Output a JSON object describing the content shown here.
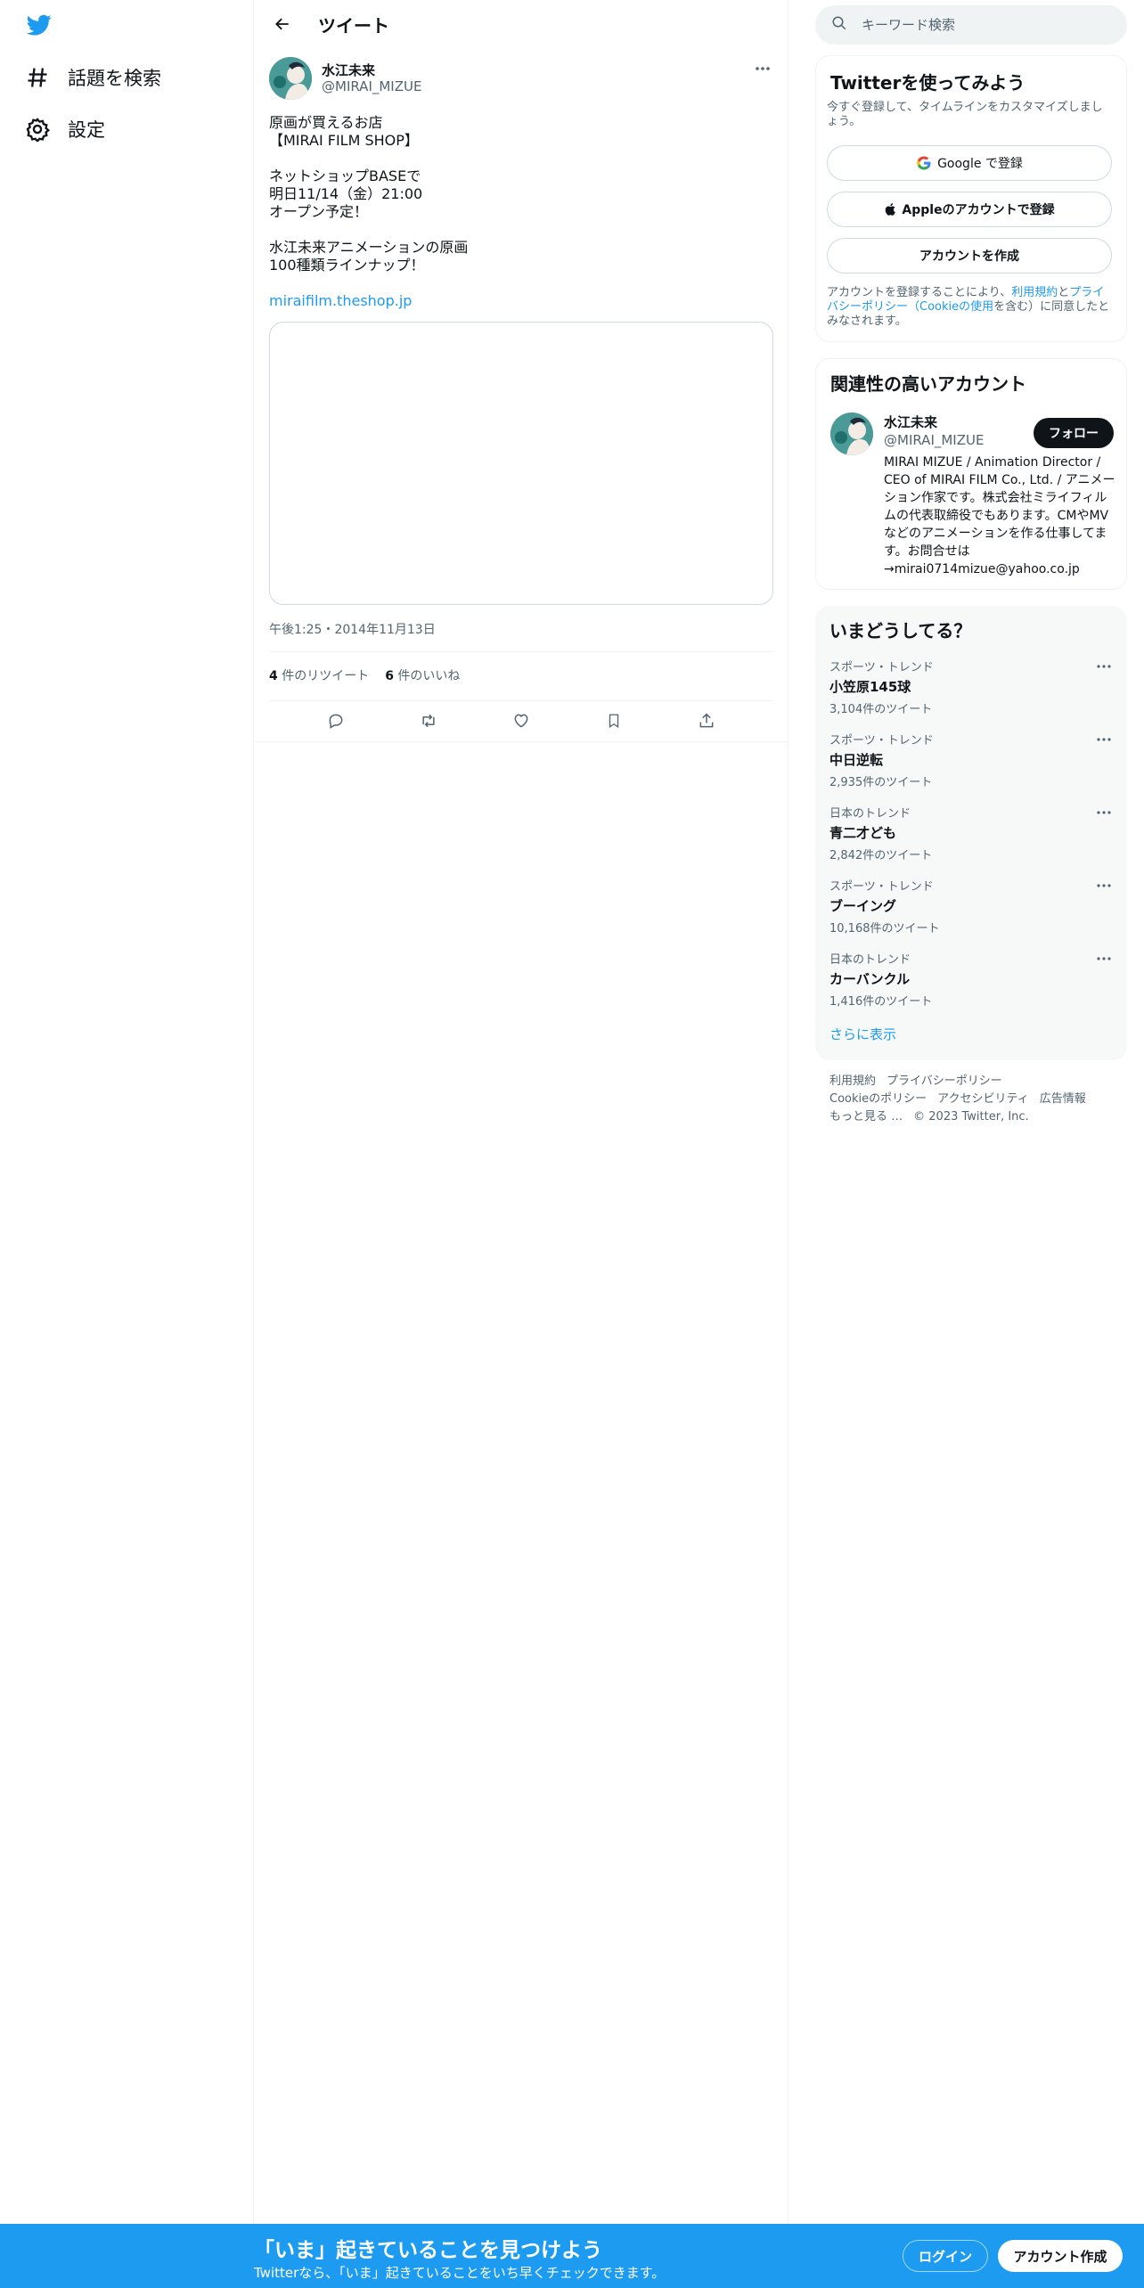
{
  "colors": {
    "brand": "#1d9bf0",
    "text": "#0f1419",
    "secondary": "#536471"
  },
  "nav": {
    "logo_icon": "twitter-bird-icon",
    "items": [
      {
        "icon": "hashtag-icon",
        "label": "話題を検索"
      },
      {
        "icon": "gear-icon",
        "label": "設定"
      }
    ]
  },
  "header": {
    "back_icon": "arrow-left-icon",
    "title": "ツイート"
  },
  "tweet": {
    "author_name": "水江未来",
    "author_handle": "@MIRAI_MIZUE",
    "text": "原画が買えるお店\n【MIRAI FILM SHOP】\n\nネットショップBASEで\n明日11/14（金）21:00\nオープン予定！\n\n水江未来アニメーションの原画\n100種類ラインナップ！",
    "link": "miraifilm.theshop.jp",
    "timestamp": "午後1:25・2014年11月13日",
    "retweets_count": "4",
    "retweets_label": "件のリツイート",
    "likes_count": "6",
    "likes_label": "件のいいね"
  },
  "search": {
    "placeholder": "キーワード検索"
  },
  "signup_box": {
    "title": "Twitterを使ってみよう",
    "description": "今すぐ登録して、タイムラインをカスタマイズしましょう。",
    "google_label": "Google で登録",
    "apple_label": "Appleのアカウントで登録",
    "create_label": "アカウントを作成",
    "legal_prefix": "アカウントを登録することにより、",
    "legal_terms": "利用規約",
    "legal_and": "と",
    "legal_privacy": "プライバシーポリシー",
    "legal_paren_open": "（",
    "legal_cookie": "Cookieの使用",
    "legal_suffix": "を含む）に同意したとみなされます。"
  },
  "related": {
    "title": "関連性の高いアカウント",
    "name": "水江未来",
    "handle": "@MIRAI_MIZUE",
    "follow_label": "フォロー",
    "bio": "MIRAI MIZUE / Animation Director / CEO of MIRAI FILM Co., Ltd. / アニメーション作家です。株式会社ミライフィルムの代表取締役でもあります。CMやMVなどのアニメーションを作る仕事してます。お問合せは→mirai0714mizue@yahoo.co.jp"
  },
  "trends": {
    "title": "いまどうしてる？",
    "items": [
      {
        "context": "スポーツ・トレンド",
        "name": "小笠原145球",
        "count": "3,104件のツイート"
      },
      {
        "context": "スポーツ・トレンド",
        "name": "中日逆転",
        "count": "2,935件のツイート"
      },
      {
        "context": "日本のトレンド",
        "name": "青二才ども",
        "count": "2,842件のツイート"
      },
      {
        "context": "スポーツ・トレンド",
        "name": "ブーイング",
        "count": "10,168件のツイート"
      },
      {
        "context": "日本のトレンド",
        "name": "カーバンクル",
        "count": "1,416件のツイート"
      }
    ],
    "show_more": "さらに表示"
  },
  "footer": {
    "terms": "利用規約",
    "privacy": "プライバシーポリシー",
    "cookie": "Cookieのポリシー",
    "accessibility": "アクセシビリティ",
    "ads": "広告情報",
    "more": "もっと見る …",
    "copyright": "© 2023 Twitter, Inc."
  },
  "bottom_bar": {
    "title": "「いま」起きていることを見つけよう",
    "subtitle": "Twitterなら、「いま」起きていることをいち早くチェックできます。",
    "login_label": "ログイン",
    "signup_label": "アカウント作成"
  }
}
